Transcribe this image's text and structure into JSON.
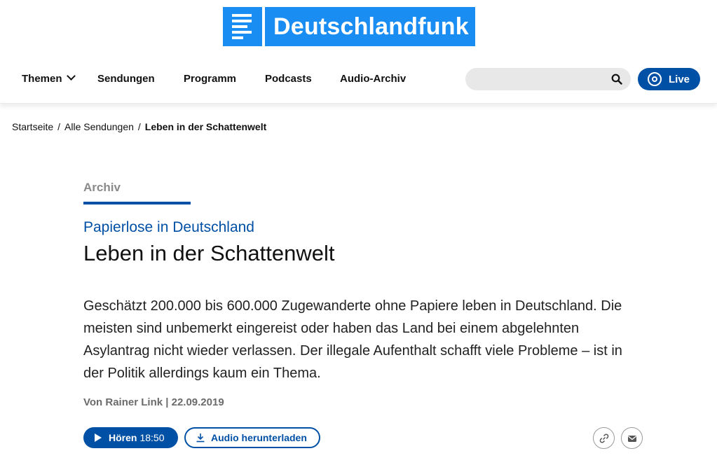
{
  "brand": {
    "name": "Deutschlandfunk",
    "color": "#1a8df2",
    "accent": "#0050a5"
  },
  "nav": {
    "items": [
      {
        "label": "Themen",
        "has_dropdown": true
      },
      {
        "label": "Sendungen"
      },
      {
        "label": "Programm"
      },
      {
        "label": "Podcasts"
      },
      {
        "label": "Audio-Archiv"
      }
    ],
    "search": {
      "placeholder": "",
      "value": "",
      "icon": "search-icon"
    },
    "live_label": "Live"
  },
  "breadcrumb": {
    "items": [
      "Startseite",
      "Alle Sendungen"
    ],
    "current": "Leben in der Schattenwelt",
    "separator": "/"
  },
  "article": {
    "kicker": "Archiv",
    "overline": "Papierlose in Deutschland",
    "headline": "Leben in der Schattenwelt",
    "teaser": "Geschätzt 200.000 bis 600.000 Zugewanderte ohne Papiere leben in Deutschland. Die meisten sind unbemerkt eingereist oder haben das Land bei einem abgelehnten Asylantrag nicht wieder verlassen. Der illegale Aufenthalt schafft viele Probleme – ist in der Politik allerdings kaum ein Thema.",
    "byline": "Von Rainer Link | 22.09.2019",
    "play": {
      "label": "Hören",
      "duration": "18:50"
    },
    "download_label": "Audio herunterladen",
    "share_icons": [
      "link-icon",
      "mail-icon"
    ]
  }
}
